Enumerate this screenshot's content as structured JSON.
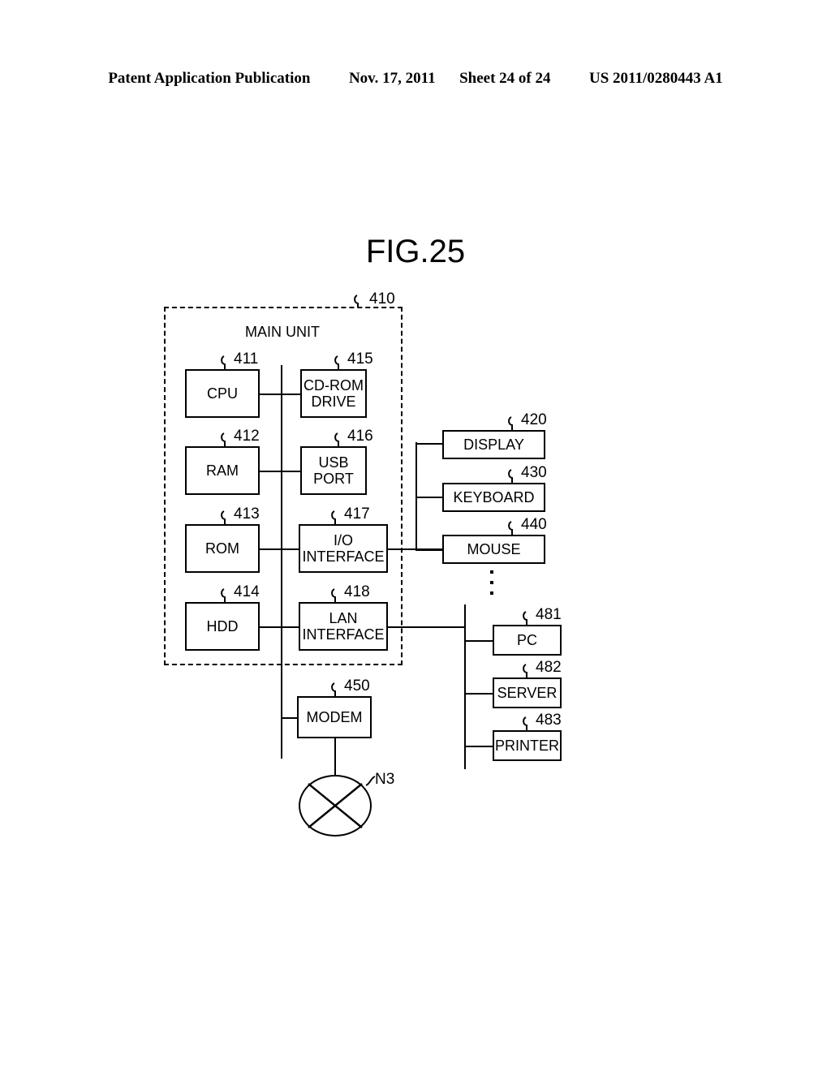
{
  "header": {
    "publication": "Patent Application Publication",
    "date": "Nov. 17, 2011",
    "sheet": "Sheet 24 of 24",
    "patent_number": "US 2011/0280443 A1"
  },
  "figure": {
    "title": "FIG.25",
    "enclosure": {
      "label": "MAIN UNIT",
      "ref": "410"
    },
    "nodes": [
      {
        "id": "cpu",
        "label": "CPU",
        "ref": "411"
      },
      {
        "id": "ram",
        "label": "RAM",
        "ref": "412"
      },
      {
        "id": "rom",
        "label": "ROM",
        "ref": "413"
      },
      {
        "id": "hdd",
        "label": "HDD",
        "ref": "414"
      },
      {
        "id": "cdrom",
        "label": "CD-ROM\nDRIVE",
        "ref": "415"
      },
      {
        "id": "usb",
        "label": "USB\nPORT",
        "ref": "416"
      },
      {
        "id": "io",
        "label": "I/O\nINTERFACE",
        "ref": "417"
      },
      {
        "id": "lan",
        "label": "LAN\nINTERFACE",
        "ref": "418"
      },
      {
        "id": "display",
        "label": "DISPLAY",
        "ref": "420"
      },
      {
        "id": "keyboard",
        "label": "KEYBOARD",
        "ref": "430"
      },
      {
        "id": "mouse",
        "label": "MOUSE",
        "ref": "440"
      },
      {
        "id": "modem",
        "label": "MODEM",
        "ref": "450"
      },
      {
        "id": "pc",
        "label": "PC",
        "ref": "481"
      },
      {
        "id": "server",
        "label": "SERVER",
        "ref": "482"
      },
      {
        "id": "printer",
        "label": "PRINTER",
        "ref": "483"
      }
    ],
    "network": {
      "symbol": "network-cloud",
      "ref": "N3"
    },
    "ellipsis": "vertical-ellipsis"
  },
  "colors": {
    "ink": "#000000",
    "paper": "#ffffff"
  }
}
